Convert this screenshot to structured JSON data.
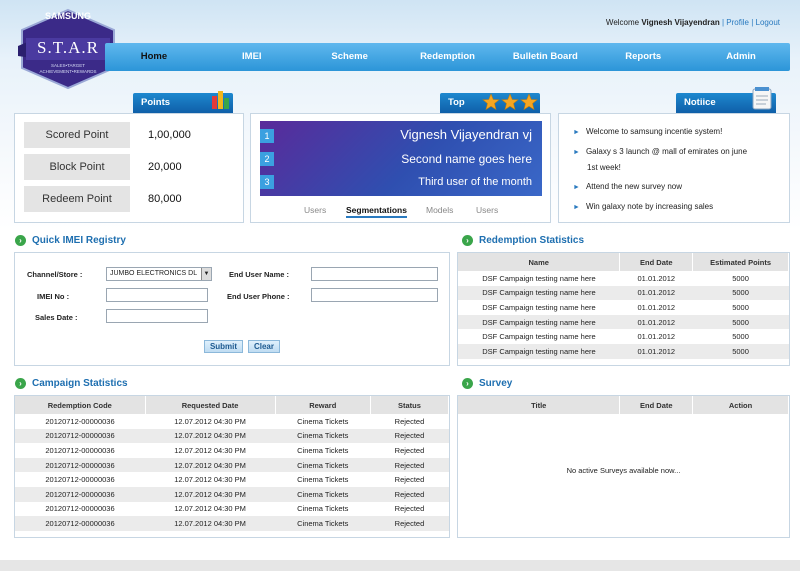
{
  "brand": {
    "name": "SAMSUNG",
    "logo_text": "S.T.A.R",
    "tagline_1": "SALES•TARGET",
    "tagline_2": "ACHIEVEMENT•REWARDS"
  },
  "header": {
    "welcome": "Welcome",
    "user": "Vignesh Vijayendran",
    "profile": "Profile",
    "separator": "|",
    "logout": "Logout"
  },
  "nav": [
    "Home",
    "IMEI",
    "Scheme",
    "Redemption",
    "Bulletin Board",
    "Reports",
    "Admin"
  ],
  "points": {
    "title": "Points",
    "rows": [
      {
        "label": "Scored Point",
        "value": "1,00,000"
      },
      {
        "label": "Block Point",
        "value": "20,000"
      },
      {
        "label": "Redeem Point",
        "value": "80,000"
      }
    ]
  },
  "top": {
    "title": "Top",
    "entries": [
      {
        "num": "1",
        "text": "Vignesh Vijayendran vj"
      },
      {
        "num": "2",
        "text": "Second name goes here"
      },
      {
        "num": "3",
        "text": "Third user of the month"
      }
    ],
    "tabs": [
      "Users",
      "Segmentations",
      "Models",
      "Users"
    ]
  },
  "notice": {
    "title": "Notiice",
    "items": [
      "Welcome to samsung incentie system!",
      "Galaxy s 3 launch @ mall of emirates on june",
      "1st week!",
      "Attend the new survey now",
      "Win galaxy note by increasing sales"
    ]
  },
  "imei": {
    "title": "Quick IMEI Registry",
    "channel_label": "Channel/Store :",
    "channel_value": "JUMBO ELECTRONICS DL",
    "imei_label": "IMEI No :",
    "sales_label": "Sales Date :",
    "user_name_label": "End User Name :",
    "user_phone_label": "End User Phone :",
    "submit": "Submit",
    "clear": "Clear"
  },
  "redemption": {
    "title": "Redemption Statistics",
    "columns": [
      "Name",
      "End Date",
      "Estimated Points"
    ],
    "rows": [
      [
        "DSF Campaign testing name here",
        "01.01.2012",
        "5000"
      ],
      [
        "DSF Campaign testing name here",
        "01.01.2012",
        "5000"
      ],
      [
        "DSF Campaign testing name here",
        "01.01.2012",
        "5000"
      ],
      [
        "DSF Campaign testing name here",
        "01.01.2012",
        "5000"
      ],
      [
        "DSF Campaign testing name here",
        "01.01.2012",
        "5000"
      ],
      [
        "DSF Campaign testing name here",
        "01.01.2012",
        "5000"
      ]
    ]
  },
  "campaign": {
    "title": "Campaign Statistics",
    "columns": [
      "Redemption Code",
      "Requested Date",
      "Reward",
      "Status"
    ],
    "rows": [
      [
        "20120712-00000036",
        "12.07.2012  04:30 PM",
        "Cinema Tickets",
        "Rejected"
      ],
      [
        "20120712-00000036",
        "12.07.2012  04:30 PM",
        "Cinema Tickets",
        "Rejected"
      ],
      [
        "20120712-00000036",
        "12.07.2012  04:30 PM",
        "Cinema Tickets",
        "Rejected"
      ],
      [
        "20120712-00000036",
        "12.07.2012  04:30 PM",
        "Cinema Tickets",
        "Rejected"
      ],
      [
        "20120712-00000036",
        "12.07.2012  04:30 PM",
        "Cinema Tickets",
        "Rejected"
      ],
      [
        "20120712-00000036",
        "12.07.2012  04:30 PM",
        "Cinema Tickets",
        "Rejected"
      ],
      [
        "20120712-00000036",
        "12.07.2012  04:30 PM",
        "Cinema Tickets",
        "Rejected"
      ],
      [
        "20120712-00000036",
        "12.07.2012  04:30 PM",
        "Cinema Tickets",
        "Rejected"
      ]
    ]
  },
  "survey": {
    "title": "Survey",
    "columns": [
      "Title",
      "End Date",
      "Action"
    ],
    "empty": "No active Surveys available now..."
  },
  "colors": {
    "nav": "#2c95d8",
    "tab": "#0f5fa8",
    "accent": "#2a7abf",
    "dot": "#3aa54a"
  }
}
